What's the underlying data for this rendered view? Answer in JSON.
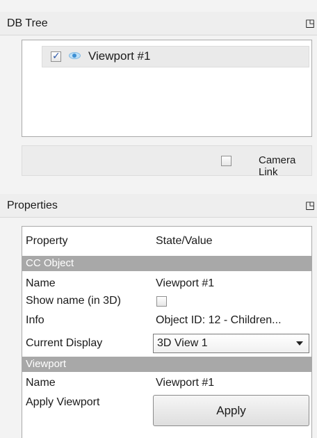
{
  "db_tree": {
    "title": "DB Tree",
    "float_icon": "float-window-icon",
    "items": [
      {
        "label": "Viewport #1",
        "checked": true,
        "icon": "eye-icon"
      }
    ],
    "camera_link": {
      "label": "Camera Link",
      "checked": false
    }
  },
  "properties": {
    "title": "Properties",
    "float_icon": "float-window-icon",
    "columns": [
      "Property",
      "State/Value"
    ],
    "groups": [
      {
        "name": "CC Object",
        "rows": [
          {
            "property": "Name",
            "value": "Viewport #1"
          },
          {
            "property": "Show name (in 3D)",
            "checked": false
          },
          {
            "property": "Info",
            "value": "Object ID: 12 - Children..."
          },
          {
            "property": "Current Display",
            "value": "3D View 1"
          }
        ]
      },
      {
        "name": "Viewport",
        "rows": [
          {
            "property": "Name",
            "value": "Viewport #1"
          },
          {
            "property": "Apply Viewport",
            "button": "Apply"
          }
        ]
      }
    ]
  },
  "colors": {
    "group_header_bg": "#a8a8a8",
    "selected_row_bg": "#eaeaea"
  }
}
